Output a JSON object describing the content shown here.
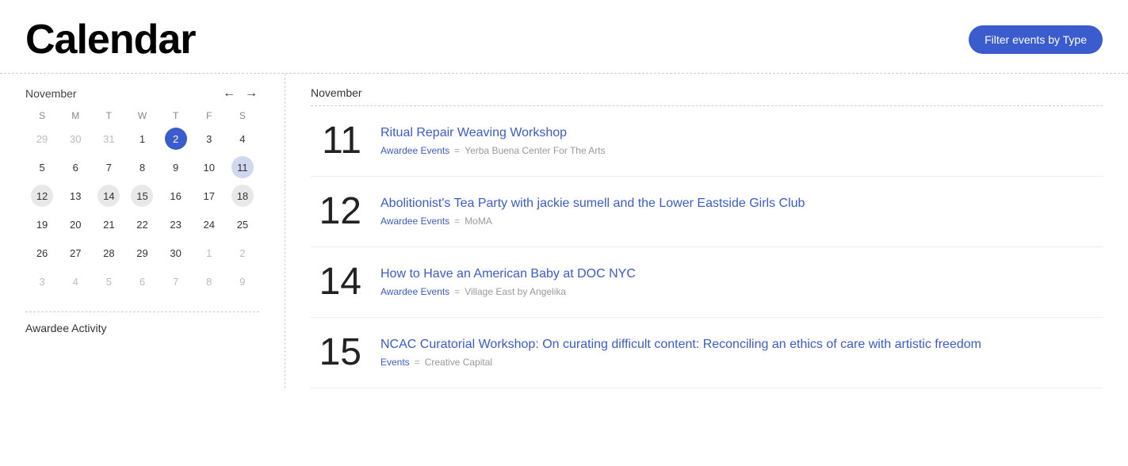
{
  "header": {
    "title": "Calendar",
    "filter_button_label": "Filter events by Type"
  },
  "calendar": {
    "month_label": "November",
    "prev_icon": "←",
    "next_icon": "→",
    "day_headers": [
      "S",
      "M",
      "T",
      "W",
      "T",
      "F",
      "S"
    ],
    "weeks": [
      [
        {
          "day": "29",
          "type": "other-month"
        },
        {
          "day": "30",
          "type": "other-month"
        },
        {
          "day": "31",
          "type": "other-month"
        },
        {
          "day": "1",
          "type": "normal"
        },
        {
          "day": "2",
          "type": "today"
        },
        {
          "day": "3",
          "type": "normal"
        },
        {
          "day": "4",
          "type": "normal"
        }
      ],
      [
        {
          "day": "5",
          "type": "normal"
        },
        {
          "day": "6",
          "type": "normal"
        },
        {
          "day": "7",
          "type": "normal"
        },
        {
          "day": "8",
          "type": "normal"
        },
        {
          "day": "9",
          "type": "normal"
        },
        {
          "day": "10",
          "type": "normal"
        },
        {
          "day": "11",
          "type": "selected"
        }
      ],
      [
        {
          "day": "12",
          "type": "has-event"
        },
        {
          "day": "13",
          "type": "normal"
        },
        {
          "day": "14",
          "type": "has-event"
        },
        {
          "day": "15",
          "type": "has-event"
        },
        {
          "day": "16",
          "type": "normal"
        },
        {
          "day": "17",
          "type": "normal"
        },
        {
          "day": "18",
          "type": "has-event"
        }
      ],
      [
        {
          "day": "19",
          "type": "normal"
        },
        {
          "day": "20",
          "type": "normal"
        },
        {
          "day": "21",
          "type": "normal"
        },
        {
          "day": "22",
          "type": "normal"
        },
        {
          "day": "23",
          "type": "normal"
        },
        {
          "day": "24",
          "type": "normal"
        },
        {
          "day": "25",
          "type": "normal"
        }
      ],
      [
        {
          "day": "26",
          "type": "normal"
        },
        {
          "day": "27",
          "type": "normal"
        },
        {
          "day": "28",
          "type": "normal"
        },
        {
          "day": "29",
          "type": "normal"
        },
        {
          "day": "30",
          "type": "normal"
        },
        {
          "day": "1",
          "type": "other-month"
        },
        {
          "day": "2",
          "type": "other-month"
        }
      ],
      [
        {
          "day": "3",
          "type": "other-month"
        },
        {
          "day": "4",
          "type": "other-month"
        },
        {
          "day": "5",
          "type": "other-month"
        },
        {
          "day": "6",
          "type": "other-month"
        },
        {
          "day": "7",
          "type": "other-month"
        },
        {
          "day": "8",
          "type": "other-month"
        },
        {
          "day": "9",
          "type": "other-month"
        }
      ]
    ],
    "awardee_activity_label": "Awardee Activity"
  },
  "events": {
    "month_label": "November",
    "items": [
      {
        "day": "11",
        "title": "Ritual Repair Weaving Workshop",
        "tag": "Awardee Events",
        "separator": "=",
        "venue": "Yerba Buena Center For The Arts"
      },
      {
        "day": "12",
        "title": "Abolitionist's Tea Party with jackie sumell and the Lower Eastside Girls Club",
        "tag": "Awardee Events",
        "separator": "=",
        "venue": "MoMA"
      },
      {
        "day": "14",
        "title": "How to Have an American Baby at DOC NYC",
        "tag": "Awardee Events",
        "separator": "=",
        "venue": "Village East by Angelika"
      },
      {
        "day": "15",
        "title": "NCAC Curatorial Workshop: On curating difficult content: Reconciling an ethics of care with artistic freedom",
        "tag": "Events",
        "separator": "=",
        "venue": "Creative Capital"
      }
    ]
  }
}
